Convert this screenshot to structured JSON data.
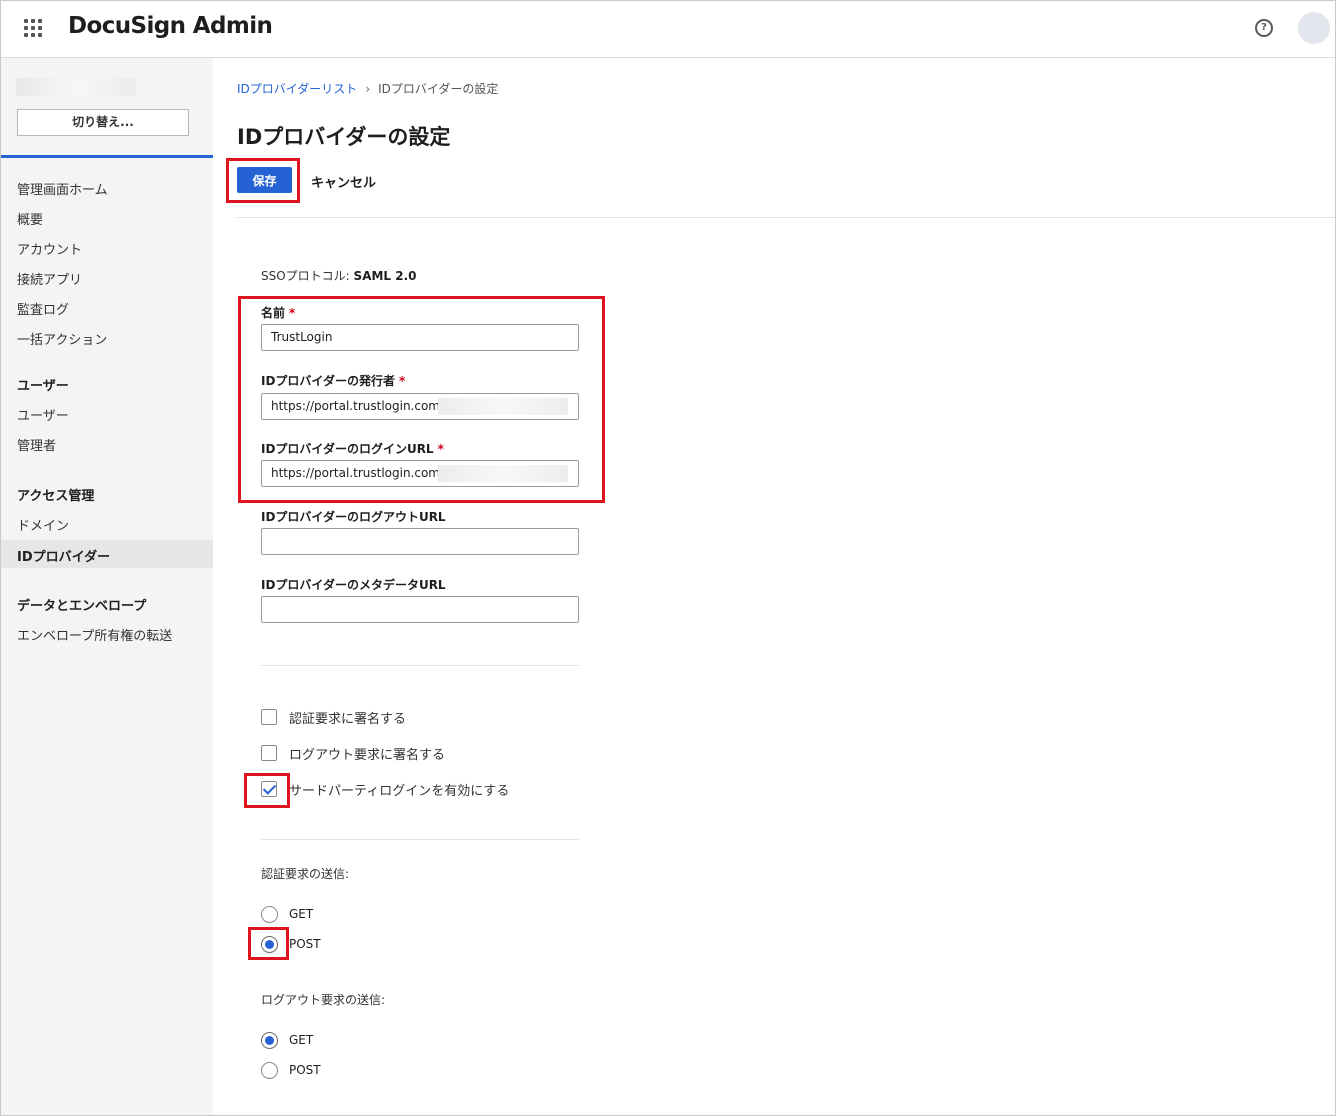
{
  "header": {
    "brand": "DocuSign Admin",
    "help_glyph": "?"
  },
  "sidebar": {
    "account_name": "・・・・",
    "switch_label": "切り替え...",
    "items": [
      "管理画面ホーム",
      "概要",
      "アカウント",
      "接続アプリ",
      "監査ログ",
      "一括アクション"
    ],
    "section_users": "ユーザー",
    "users_items": [
      "ユーザー",
      "管理者"
    ],
    "section_access": "アクセス管理",
    "access_items": [
      "ドメイン",
      "IDプロバイダー"
    ],
    "section_data": "データとエンベロープ",
    "data_items": [
      "エンベロープ所有権の転送"
    ]
  },
  "breadcrumb": {
    "parent": "IDプロバイダーリスト",
    "separator": "›",
    "current": "IDプロバイダーの設定"
  },
  "page": {
    "title": "IDプロバイダーの設定",
    "save_label": "保存",
    "cancel_label": "キャンセル"
  },
  "form": {
    "protocol_label": "SSOプロトコル: ",
    "protocol_value": "SAML 2.0",
    "required_mark": "*",
    "name_label": "名前",
    "name_value": "TrustLogin",
    "issuer_label": "IDプロバイダーの発行者",
    "issuer_value": "https://portal.trustlogin.com/",
    "login_url_label": "IDプロバイダーのログインURL",
    "login_url_value": "https://portal.trustlogin.com/",
    "logout_url_label": "IDプロバイダーのログアウトURL",
    "logout_url_value": "",
    "metadata_url_label": "IDプロバイダーのメタデータURL",
    "metadata_url_value": "",
    "sign_auth_label": "認証要求に署名する",
    "sign_auth_checked": false,
    "sign_logout_label": "ログアウト要求に署名する",
    "sign_logout_checked": false,
    "third_party_label": "サードパーティログインを有効にする",
    "third_party_checked": true,
    "auth_send_label": "認証要求の送信:",
    "auth_send_options": [
      "GET",
      "POST"
    ],
    "auth_send_selected": "POST",
    "logout_send_label": "ログアウト要求の送信:",
    "logout_send_options": [
      "GET",
      "POST"
    ],
    "logout_send_selected": "GET"
  },
  "colors": {
    "accent": "#2563d4",
    "highlight": "#e0141e",
    "required": "#d0021b",
    "sidebar_bg": "#f4f4f4"
  }
}
